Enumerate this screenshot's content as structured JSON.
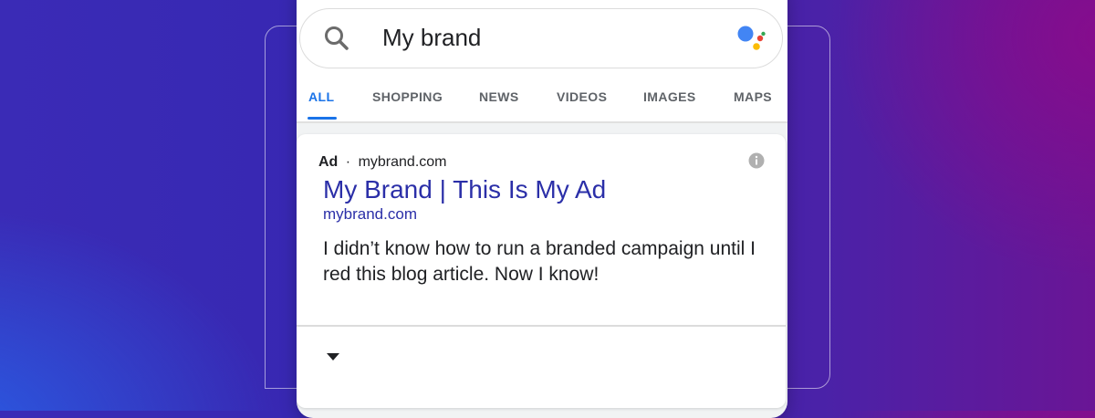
{
  "search": {
    "query": "My brand"
  },
  "tabs": [
    {
      "label": "ALL",
      "active": true
    },
    {
      "label": "SHOPPING",
      "active": false
    },
    {
      "label": "NEWS",
      "active": false
    },
    {
      "label": "VIDEOS",
      "active": false
    },
    {
      "label": "IMAGES",
      "active": false
    },
    {
      "label": "MAPS",
      "active": false
    }
  ],
  "ad": {
    "label": "Ad",
    "separator": "·",
    "domain": "mybrand.com",
    "title": "My Brand | This Is My Ad",
    "display_url": "mybrand.com",
    "description": "I didn’t know how to run a branded campaign until I red this blog article. Now I know!"
  },
  "icons": {
    "search": "search-icon",
    "assistant": "google-assistant-icon",
    "info": "info-icon",
    "expand": "chevron-down-icon"
  },
  "colors": {
    "active_tab": "#1a73e8",
    "ad_link": "#2b2fa8",
    "assistant_blue": "#4285f4",
    "assistant_red": "#ea4335",
    "assistant_yellow": "#fbbc05",
    "assistant_green": "#34a853"
  }
}
